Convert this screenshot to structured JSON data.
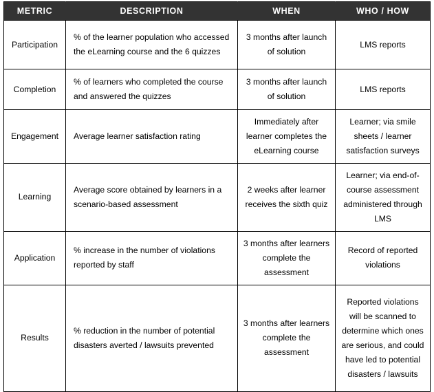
{
  "table": {
    "columns": [
      {
        "key": "metric",
        "label": "METRIC"
      },
      {
        "key": "description",
        "label": "DESCRIPTION"
      },
      {
        "key": "when",
        "label": "WHEN"
      },
      {
        "key": "who_how",
        "label": "WHO / HOW"
      }
    ],
    "header_background": "#333333",
    "header_text_color": "#ffffff",
    "border_color": "#000000",
    "rows": [
      {
        "metric": "Participation",
        "description": "% of the learner population who accessed the eLearning course and the 6 quizzes",
        "when": "3 months after launch of solution",
        "who_how": "LMS reports"
      },
      {
        "metric": "Completion",
        "description": "% of learners who completed the course and answered the quizzes",
        "when": "3 months after launch of solution",
        "who_how": "LMS reports"
      },
      {
        "metric": "Engagement",
        "description": "Average learner satisfaction rating",
        "when": "Immediately after learner completes the eLearning course",
        "who_how": "Learner; via smile sheets / learner satisfaction surveys"
      },
      {
        "metric": "Learning",
        "description": "Average score obtained by learners in a scenario-based assessment",
        "when": "2 weeks after learner receives the sixth quiz",
        "who_how": "Learner; via end-of-course assessment administered through LMS"
      },
      {
        "metric": "Application",
        "description": "% increase in the number of violations reported by staff",
        "when": "3 months after learners complete the assessment",
        "who_how": "Record of reported violations"
      },
      {
        "metric": "Results",
        "description": "% reduction in the number of potential disasters averted / lawsuits prevented",
        "when": "3 months after learners complete the assessment",
        "who_how": "Reported violations will be scanned to determine which ones are serious, and could have led to potential disasters / lawsuits"
      }
    ]
  }
}
